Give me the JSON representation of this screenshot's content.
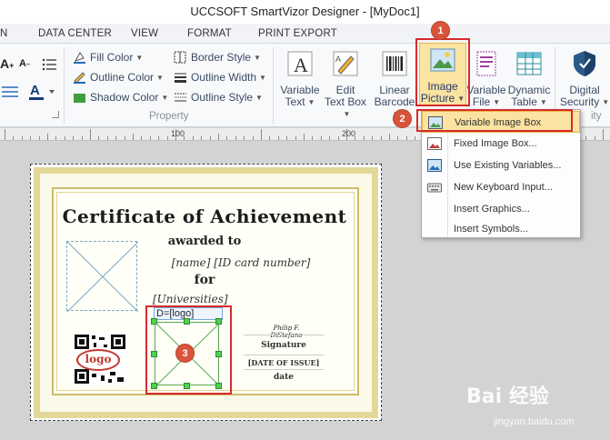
{
  "window": {
    "title": "UCCSOFT SmartVizor Designer - [MyDoc1]"
  },
  "tabs": [
    {
      "label": "DATA CENTER"
    },
    {
      "label": "VIEW"
    },
    {
      "label": "FORMAT"
    },
    {
      "label": "PRINT EXPORT"
    }
  ],
  "ribbon": {
    "property": {
      "fill_color": "Fill Color",
      "outline_color": "Outline Color",
      "shadow_color": "Shadow Color",
      "border_style": "Border Style",
      "outline_width": "Outline Width",
      "outline_style": "Outline Style",
      "group_label": "Property"
    },
    "insert": {
      "variable_text": [
        "Variable",
        "Text"
      ],
      "edit_text_box": [
        "Edit",
        "Text Box"
      ],
      "linear_barcode": [
        "Linear",
        "Barcode"
      ],
      "image_picture": [
        "Image",
        "Picture"
      ],
      "variable_file": [
        "Variable",
        "File"
      ],
      "dynamic_table": [
        "Dynamic",
        "Table"
      ],
      "digital_security": [
        "Digital",
        "Security"
      ],
      "group_label_partial": "ity"
    }
  },
  "ruler": {
    "marks": [
      "100",
      "200"
    ]
  },
  "dropdown": {
    "items": [
      {
        "label": "Variable Image Box",
        "highlighted": true
      },
      {
        "label": "Fixed Image Box...",
        "highlighted": false
      },
      {
        "label": "Use Existing Variables...",
        "highlighted": false
      },
      {
        "label": "New Keyboard Input...",
        "highlighted": false
      },
      {
        "label": "Insert Graphics...",
        "highlighted": false
      },
      {
        "label": "Insert Symbols...",
        "highlighted": false
      }
    ]
  },
  "certificate": {
    "title": "Certificate of Achievement",
    "awarded": "awarded to",
    "name_line": "[name]  [ID card number]",
    "for": "for",
    "universities": "[Universities]",
    "logo": "logo",
    "signature_hand": "Philip F. DiStefano",
    "signature": "Signature",
    "date_of_issue": "[DATE OF ISSUE]",
    "date": "date"
  },
  "variable_box": {
    "label": "D=[logo]"
  },
  "badges": [
    "1",
    "2",
    "3"
  ],
  "watermark": {
    "brand": "Bai 经验",
    "url": "jingyan.baidu.com"
  },
  "colors": {
    "accent_red": "#d62b2b",
    "badge": "#d8543a",
    "highlight": "#fbe3a1",
    "gold": "#cbbd6a"
  }
}
